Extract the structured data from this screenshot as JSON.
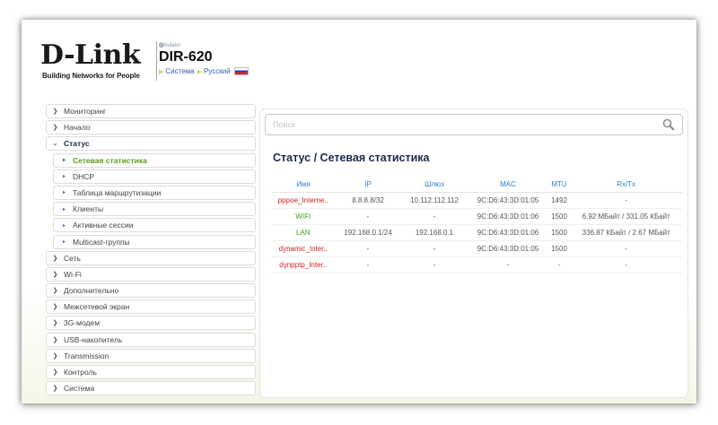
{
  "header": {
    "logo_text": "D-Link",
    "logo_reg": "®",
    "tagline": "Building Networks for People",
    "emulator_label": "emulator",
    "model": "DIR-620",
    "breadcrumb": [
      "Система",
      "Русский"
    ]
  },
  "sidebar": {
    "items": [
      {
        "label": "Мониторинг"
      },
      {
        "label": "Начало"
      },
      {
        "label": "Статус"
      },
      {
        "label": "Сетевая статистика"
      },
      {
        "label": "DHCP"
      },
      {
        "label": "Таблица маршрутизации"
      },
      {
        "label": "Клиенты"
      },
      {
        "label": "Активные сессии"
      },
      {
        "label": "Multicast-группы"
      },
      {
        "label": "Сеть"
      },
      {
        "label": "Wi-Fi"
      },
      {
        "label": "Дополнительно"
      },
      {
        "label": "Межсетевой экран"
      },
      {
        "label": "3G-модем"
      },
      {
        "label": "USB-накопитель"
      },
      {
        "label": "Transmission"
      },
      {
        "label": "Контроль"
      },
      {
        "label": "Система"
      }
    ]
  },
  "search": {
    "placeholder": "Поиск",
    "value": ""
  },
  "page": {
    "title": "Статус /  Сетевая статистика"
  },
  "table": {
    "headers": [
      "Имя",
      "IP",
      "Шлюз",
      "MAC",
      "MTU",
      "Rx/Tx"
    ],
    "rows": [
      [
        "pppoe_Interne..",
        "8.8.8.8/32",
        "10.112.112.112",
        "9C:D6:43:3D:01:05",
        "1492",
        "-"
      ],
      [
        "WIFI",
        "-",
        "-",
        "9C:D6:43:3D:01:06",
        "1500",
        "6.92 МБайт / 331.05 КБайт"
      ],
      [
        "LAN",
        "192.168.0.1/24",
        "192.168.0.1",
        "9C:D6:43:3D:01:06",
        "1500",
        "336.87 КБайт / 2.67 МБайт"
      ],
      [
        "dynamic_Inter..",
        "-",
        "-",
        "9C:D6:43:3D:01:05",
        "1500",
        "-"
      ],
      [
        "dynpptp_Inter..",
        "-",
        "-",
        "-",
        "-",
        "-"
      ]
    ]
  },
  "colors": {
    "accent_blue": "#2a7fd0",
    "active_green": "#5f9a1a",
    "status_red": "#d42020",
    "status_green": "#4c9a12"
  }
}
